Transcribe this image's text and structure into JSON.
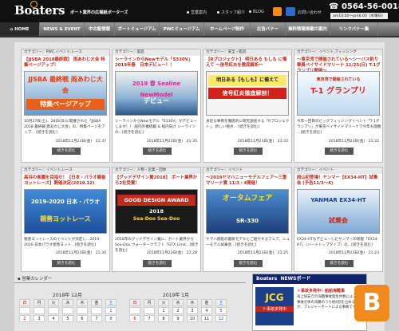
{
  "header": {
    "logo": "Boaters",
    "tagline": "ボート業界の広報紙ボーターズ",
    "links": [
      "営業案内",
      "スタッフ紹介",
      "BLOG"
    ],
    "contact": "お問い合わせ",
    "phone": "0564-56-0018",
    "hours": "am10:00〜pm6:00（水曜日）"
  },
  "nav": {
    "items": [
      "HOME",
      "NEWS & EVENT",
      "中古艇情報",
      "ボートミュージアム",
      "PWCミュージアム",
      "ホームページ制作",
      "広告バナー",
      "無料情報掲載の案内",
      "リンクバナー集"
    ],
    "sub": "WEBやホ運営"
  },
  "cards": [
    {
      "cat": "カテゴリー：PWC,イベント,レース",
      "title": "【JJSBA 2018最終戦】 雨あわじ大会 特集ページアップ！",
      "img_label": "JJSBA 最終戦 雨あわじ大会",
      "img_sub": "特集ページアップ",
      "desc": "10月27日(土)、28日(日)に開催された「JJSBA 2018 最終戦 雨あわじ大会」の、特集ページをアップ… [続きを読む]",
      "date": "2018年11月23日(金)　21:37",
      "more": "続きを読む"
    },
    {
      "cat": "カテゴリー：艇品",
      "title": "シーラインからNewモデル「S330V」2019年春　日本デビュー！！",
      "img_label": "2019 春 Sealine NewModel",
      "img_sub": "デビュー",
      "desc": "シーラインからNewモデル「S330V」がデビュー します！！ 船内外機搭載 & 船内向け シーラインの…[続きを読む]",
      "date": "2018年11月23日(金)　21:35",
      "more": "続きを読む"
    },
    {
      "cat": "カテゴリー：安全・艇品",
      "title": "【Rプロジェクト】 明日ある もしも に備えて 〜信号紅炎を徹底解析〜",
      "img_label": "明日ある【もしも】に備えて",
      "img_sub": "信号紅炎徹底解剖！",
      "desc": "身近な事例を徹底的に研究調査する「Rプロジェクト」。新しい視点... [続きを読む]",
      "date": "2018年11月23日(金)　21:33",
      "more": "続きを読む"
    },
    {
      "cat": "カテゴリー：イベント,フィッシング",
      "title": "〜東京湾で開催されている〜シーバス釣り 乗員ベイサイドマリーナ 11/25(日) T-1グランプリ開催〜",
      "img_label": "東京湾で開催されている",
      "img_sub": "T-1 グランプリ",
      "desc": "今年一回目のビッグフィッシングイベント「T-1グランプリ」が東京ベイサイドマリーナで今年も開催 …[続きを読む]",
      "date": "2018年11月23日(金)　21:32",
      "more": "続きを読む"
    },
    {
      "cat": "カテゴリー：イベント,レース",
      "title": "高浜の楽園を目指せ！【日本・パラオ親善ヨットレース】開催決定(2019.12)",
      "img_label": "2019-2020 日本・パラオ",
      "img_sub": "親善ヨットレース",
      "desc": "親善ヨットレースのイベントが決定し…2019-2020 日本パラオ親善ヨット…[続きを読む]",
      "date": "2018年11月23日(金)　21:30",
      "more": "続きを読む"
    },
    {
      "cat": "カテゴリー：人物・企業・団体",
      "title": "【グッドデザイン賞2018】 ボート業界から2社受賞！",
      "img_label": "GOOD DESIGN AWARD 2018",
      "img_sub": "Sea-Doo Sea-Doo",
      "desc": "2018年のグッドデザイン賞に、ボート業界からSea-Doo ウォータークラフト「GTX Limit…[続きを読む]",
      "date": "2018年11月23日(金)　21:28",
      "more": "続きを読む"
    },
    {
      "cat": "カテゴリー：イベント",
      "title": "〜2019ヤマハニューモデルフェア〜三重マリーナ賞 11/3・4開催！",
      "img_label": "オータムフェア",
      "img_sub": "SR-330",
      "desc": "ヤマハ新艇の最新モデルとご紹介するフェア。ニューモデル試乗会…[続きを読む]",
      "date": "2018年11月23日(金)　21:25",
      "more": "続きを読む"
    },
    {
      "cat": "カテゴリー：イベント",
      "title": "岡山初登場！ヤンマー【EX34-HT】試乗会 (予告11/3〜4)",
      "img_label": "YANMAR EX34-HT",
      "img_sub": "試乗会",
      "desc": "EX34-HTもデビューしたヤンマーの新艇「EX34-HT」（ハードトップタイプ）の…[続きを読む]",
      "date": "2018年11月23日(金)　21:23",
      "more": "続きを読む"
    }
  ],
  "calendar": {
    "heading": "営業カレンダー",
    "months": [
      {
        "label": "2018年 12月",
        "weekdays": [
          "日",
          "月",
          "火",
          "水",
          "木",
          "金",
          "土"
        ],
        "rows": [
          [
            "",
            "",
            "",
            "",
            "",
            "",
            "1"
          ],
          [
            "2",
            "3",
            "4",
            "5",
            "6",
            "7",
            "8"
          ]
        ]
      },
      {
        "label": "2019年 1月",
        "weekdays": [
          "日",
          "月",
          "火",
          "水",
          "木",
          "金",
          "土"
        ],
        "rows": [
          [
            "",
            "",
            "1",
            "2",
            "3",
            "4",
            "5"
          ],
          [
            "6",
            "7",
            "8",
            "9",
            "10",
            "11",
            "12"
          ]
        ]
      }
    ]
  },
  "news": {
    "logo": "Boaters",
    "title": "NEWSボード",
    "jcg": "JCG",
    "jcg_sub": "ト事故多発中",
    "headline": "ト事故多発中！船舶海難事",
    "body": "海上保安庁の海難事故発生件数によると、事故全体の海難のうち約6割を占めるのが、プレジャーボートによる事故です…"
  },
  "badge": "B",
  "colors": {
    "header": "#101010",
    "nav": "#6a6a6a",
    "accent": "#c0291d",
    "news": "#12226a",
    "badge": "#f08a1c"
  }
}
